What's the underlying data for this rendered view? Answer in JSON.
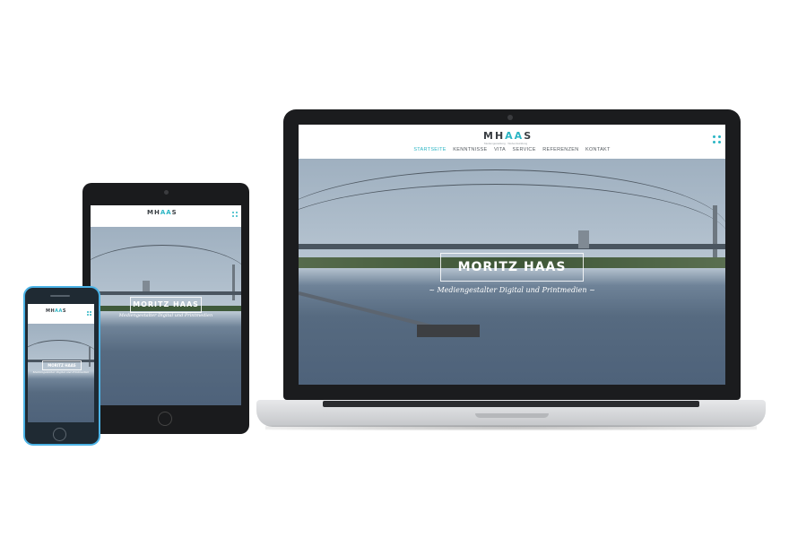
{
  "site": {
    "logo": {
      "part1": "MH",
      "accent": "AA",
      "part2": "S"
    },
    "logo_tagline": "Mediengestaltung · Webentwicklung",
    "nav": [
      "STARTSEITE",
      "KENNTNISSE",
      "VITA",
      "SERVICE",
      "REFERENZEN",
      "KONTAKT"
    ],
    "active_nav": "STARTSEITE",
    "hero_name": "MORITZ HAAS",
    "hero_subtitle": "~ Mediengestalter Digital und Printmedien ~",
    "hero_subtitle_short": "Mediengestalter Digital und Printmedien"
  },
  "colors": {
    "accent": "#2bb5c4",
    "phone_frame": "#4bb3e6",
    "device_black": "#1b1c1e"
  },
  "icons": {
    "menu": "dots-grid-icon",
    "camera": "camera-icon",
    "home_button": "home-button-icon"
  }
}
